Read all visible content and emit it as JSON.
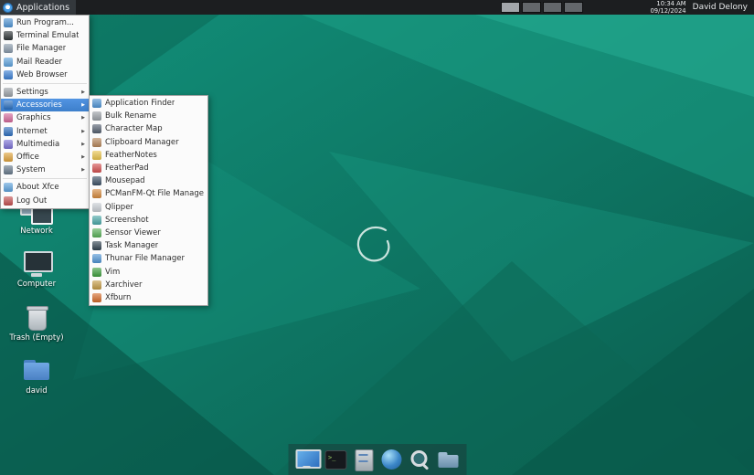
{
  "colors": {
    "accent": "#4a90d9",
    "panel_bg": "#1c1e20",
    "desktop_teal": "#0f8a74",
    "menu_bg": "#fbfbfb"
  },
  "panel": {
    "applications_label": "Applications",
    "applications_icon": "xfce-mouse-logo",
    "tasklist": {
      "items": [
        {
          "selected": true
        },
        {},
        {},
        {}
      ]
    },
    "tray": {
      "items": [
        {
          "icon": "network"
        },
        {
          "icon": "volume"
        },
        {
          "icon": "battery"
        },
        {
          "icon": "bell"
        }
      ]
    },
    "clock": {
      "time": "10:34 AM",
      "date": "09/12/2024"
    },
    "user": "David Delony"
  },
  "applications_menu": {
    "items": [
      {
        "label": "Run Program...",
        "icon": "run",
        "icon_color": "#4f94d4"
      },
      {
        "label": "Terminal Emulator",
        "icon": "terminal",
        "icon_color": "#2d3436"
      },
      {
        "label": "File Manager",
        "icon": "file-manager",
        "icon_color": "#8899aa"
      },
      {
        "label": "Mail Reader",
        "icon": "mail",
        "icon_color": "#5da2dc"
      },
      {
        "label": "Web Browser",
        "icon": "web-browser",
        "icon_color": "#3b7fd4"
      },
      {
        "type": "separator"
      },
      {
        "label": "Settings",
        "icon": "settings",
        "icon_color": "#9aa0a6",
        "submenu": true
      },
      {
        "label": "Accessories",
        "icon": "accessories",
        "icon_color": "#2a6fc0",
        "submenu": true,
        "selected": true
      },
      {
        "label": "Graphics",
        "icon": "graphics",
        "icon_color": "#d4699a",
        "submenu": true
      },
      {
        "label": "Internet",
        "icon": "internet",
        "icon_color": "#2f6fbf",
        "submenu": true
      },
      {
        "label": "Multimedia",
        "icon": "multimedia",
        "icon_color": "#7a6fd4",
        "submenu": true
      },
      {
        "label": "Office",
        "icon": "office",
        "icon_color": "#e0a33c",
        "submenu": true
      },
      {
        "label": "System",
        "icon": "system",
        "icon_color": "#66788a",
        "submenu": true
      },
      {
        "type": "separator"
      },
      {
        "label": "About Xfce",
        "icon": "about-xfce",
        "icon_color": "#5da2dc"
      },
      {
        "label": "Log Out",
        "icon": "log-out",
        "icon_color": "#c34f4f"
      }
    ]
  },
  "accessories_submenu": {
    "items": [
      {
        "label": "Application Finder",
        "icon": "application-finder",
        "icon_color": "#4f94d4"
      },
      {
        "label": "Bulk Rename",
        "icon": "bulk-rename",
        "icon_color": "#9aa0a6"
      },
      {
        "label": "Character Map",
        "icon": "character-map",
        "icon_color": "#556070"
      },
      {
        "label": "Clipboard Manager",
        "icon": "clipboard-manager",
        "icon_color": "#b5855a"
      },
      {
        "label": "FeatherNotes",
        "icon": "feathernotes",
        "icon_color": "#e8c34a"
      },
      {
        "label": "FeatherPad",
        "icon": "featherpad",
        "icon_color": "#d45050"
      },
      {
        "label": "Mousepad",
        "icon": "mousepad",
        "icon_color": "#3d5166"
      },
      {
        "label": "PCManFM-Qt File Manager",
        "icon": "pcmanfm-qt",
        "icon_color": "#d4883c"
      },
      {
        "label": "Qlipper",
        "icon": "qlipper",
        "icon_color": "#c8ced4"
      },
      {
        "label": "Screenshot",
        "icon": "screenshot",
        "icon_color": "#49a8a8"
      },
      {
        "label": "Sensor Viewer",
        "icon": "sensor-viewer",
        "icon_color": "#58b058"
      },
      {
        "label": "Task Manager",
        "icon": "task-manager",
        "icon_color": "#31424f"
      },
      {
        "label": "Thunar File Manager",
        "icon": "thunar",
        "icon_color": "#4f94d4"
      },
      {
        "label": "Vim",
        "icon": "vim",
        "icon_color": "#3f9f3f"
      },
      {
        "label": "Xarchiver",
        "icon": "xarchiver",
        "icon_color": "#c49a44"
      },
      {
        "label": "Xfburn",
        "icon": "xfburn",
        "icon_color": "#d46a2a"
      }
    ]
  },
  "desktop": {
    "icons": [
      {
        "label": "Network",
        "icon": "network"
      },
      {
        "label": "Computer",
        "icon": "computer"
      },
      {
        "label": "Trash (Empty)",
        "icon": "trash"
      },
      {
        "label": "david",
        "icon": "folder"
      }
    ]
  },
  "dock": {
    "items": [
      {
        "icon": "display"
      },
      {
        "icon": "terminal"
      },
      {
        "icon": "file-cabinet"
      },
      {
        "icon": "web-browser"
      },
      {
        "icon": "app-finder"
      },
      {
        "icon": "folder"
      }
    ]
  }
}
